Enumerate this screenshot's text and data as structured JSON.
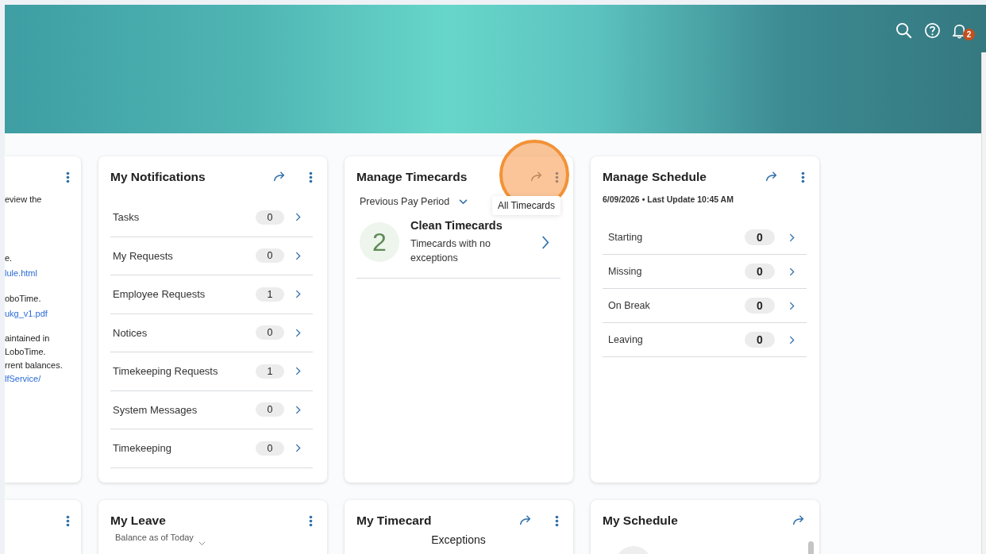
{
  "header": {
    "notification_count": "2"
  },
  "partial_card": {
    "paragraphs": [
      [
        {
          "kind": "text",
          "text": "eview the"
        }
      ],
      [
        {
          "kind": "text",
          "text": "e."
        },
        {
          "kind": "link",
          "text": "lule.html"
        }
      ],
      [
        {
          "kind": "text",
          "text": "oboTime."
        },
        {
          "kind": "link",
          "text": "ukg_v1.pdf"
        }
      ],
      [
        {
          "kind": "text",
          "text": "aintained in"
        },
        {
          "kind": "text",
          "text": "LoboTime."
        },
        {
          "kind": "text",
          "text": "rrent balances."
        },
        {
          "kind": "link",
          "text": "lfService/"
        }
      ]
    ]
  },
  "notifications": {
    "title": "My Notifications",
    "items": [
      {
        "label": "Tasks",
        "count": "0"
      },
      {
        "label": "My Requests",
        "count": "0"
      },
      {
        "label": "Employee Requests",
        "count": "1"
      },
      {
        "label": "Notices",
        "count": "0"
      },
      {
        "label": "Timekeeping Requests",
        "count": "1"
      },
      {
        "label": "System Messages",
        "count": "0"
      },
      {
        "label": "Timekeeping",
        "count": "0"
      }
    ]
  },
  "manage_timecards": {
    "title": "Manage Timecards",
    "period": "Previous Pay Period",
    "tooltip": "All Timecards",
    "summary": {
      "count": "2",
      "title": "Clean Timecards",
      "description": "Timecards with no exceptions"
    }
  },
  "manage_schedule": {
    "title": "Manage Schedule",
    "subtitle": "6/09/2026 • Last Update 10:45 AM",
    "items": [
      {
        "label": "Starting",
        "count": "0"
      },
      {
        "label": "Missing",
        "count": "0"
      },
      {
        "label": "On Break",
        "count": "0"
      },
      {
        "label": "Leaving",
        "count": "0"
      }
    ]
  },
  "my_leave": {
    "title": "My Leave",
    "subtitle": "Balance as of Today"
  },
  "my_timecard": {
    "title": "My Timecard",
    "section": "Exceptions"
  },
  "my_schedule": {
    "title": "My Schedule"
  }
}
